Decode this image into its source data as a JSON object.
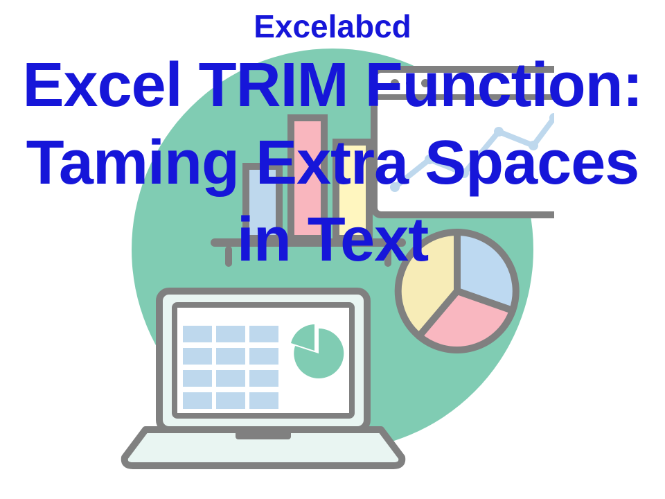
{
  "brand": "Excelabcd",
  "title": "Excel TRIM Function: Taming Extra Spaces in Text",
  "colors": {
    "text": "#1616d9",
    "bg_circle": "#80ccb3",
    "outline": "#808080",
    "bar1": "#bed8ed",
    "bar2": "#f9b6be",
    "bar3": "#fff6bf",
    "window_bg": "#ffffff",
    "pie1": "#bdd9f1",
    "pie2": "#f7ecb7",
    "pie3": "#f9b7c0",
    "laptop_body": "#e9f5f2",
    "laptop_screen": "#ffffff",
    "laptop_cell": "#bed8ed",
    "laptop_accent": "#80ccb3"
  }
}
